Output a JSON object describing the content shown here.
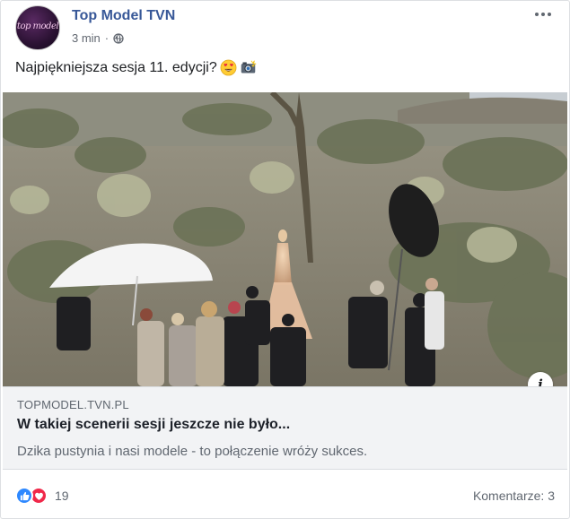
{
  "post": {
    "page_name": "Top Model TVN",
    "avatar_text": "top model",
    "time": "3 min",
    "separator": "·",
    "privacy_icon": "globe-icon",
    "more_icon": "more-options-icon",
    "text": "Najpiękniejsza sesja 11. edycji?",
    "emojis": [
      "heart-eyes-emoji",
      "camera-flash-emoji"
    ]
  },
  "photo": {
    "description_icon": "info-icon",
    "info_label": "i"
  },
  "link": {
    "domain": "TOPMODEL.TVN.PL",
    "title": "W takiej scenerii sesji jeszcze nie było...",
    "description": "Dzika pustynia i nasi modele - to połączenie wróży sukces."
  },
  "footer": {
    "reaction_icons": [
      "like-icon",
      "love-icon"
    ],
    "reaction_count": "19",
    "comments_label": "Komentarze: 3"
  },
  "colors": {
    "page_name": "#385898",
    "like": "#2d88ff",
    "love": "#f0284a",
    "link_bg": "#f2f3f5"
  }
}
